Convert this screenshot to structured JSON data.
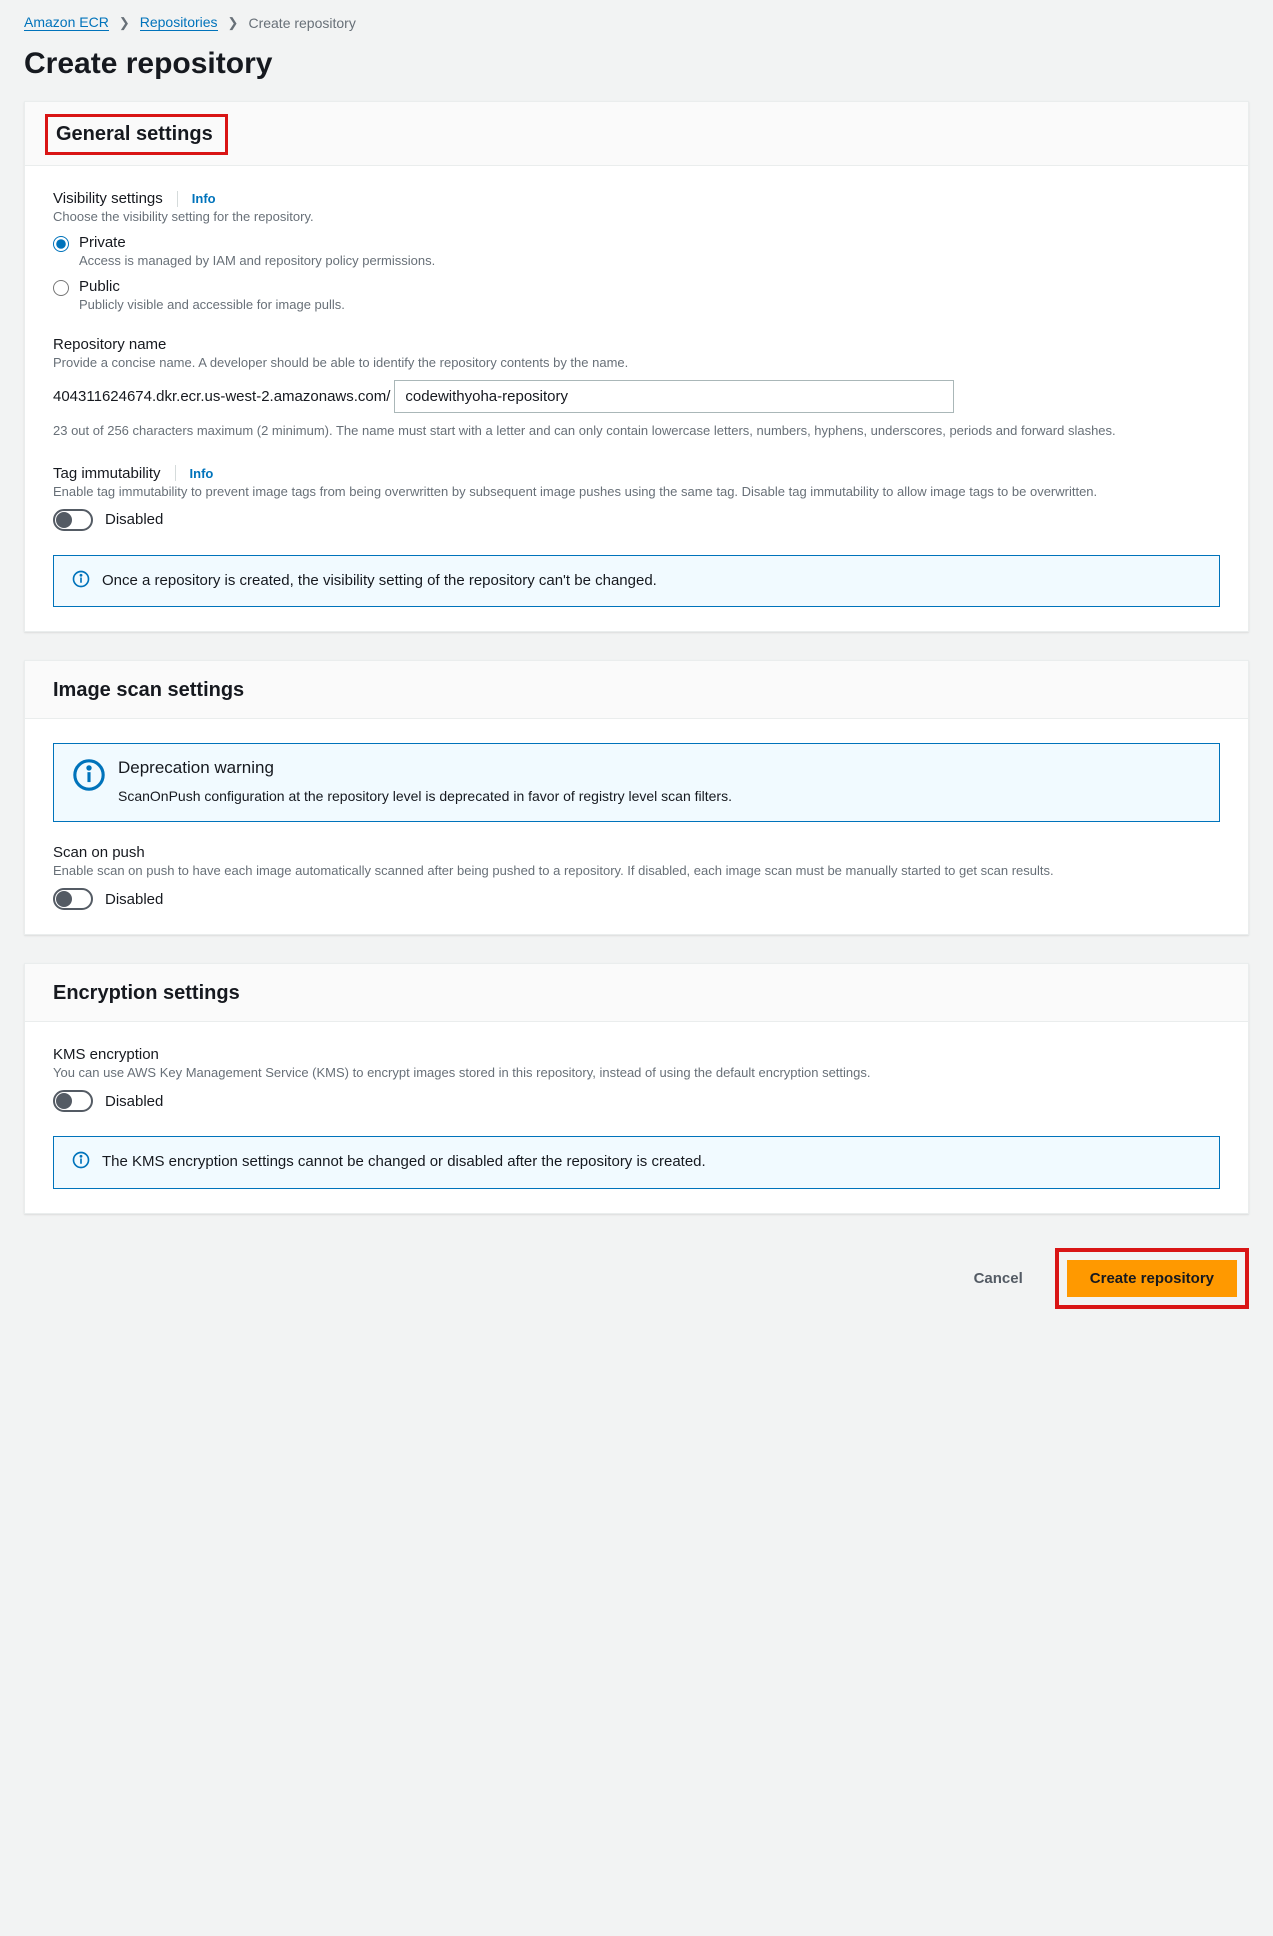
{
  "breadcrumb": {
    "root": "Amazon ECR",
    "mid": "Repositories",
    "current": "Create repository"
  },
  "page_title": "Create repository",
  "general": {
    "heading": "General settings",
    "visibility": {
      "label": "Visibility settings",
      "info": "Info",
      "desc": "Choose the visibility setting for the repository.",
      "private_label": "Private",
      "private_desc": "Access is managed by IAM and repository policy permissions.",
      "public_label": "Public",
      "public_desc": "Publicly visible and accessible for image pulls."
    },
    "repo_name": {
      "label": "Repository name",
      "desc": "Provide a concise name. A developer should be able to identify the repository contents by the name.",
      "prefix": "404311624674.dkr.ecr.us-west-2.amazonaws.com/",
      "value": "codewithyoha-repository",
      "hint": "23 out of 256 characters maximum (2 minimum). The name must start with a letter and can only contain lowercase letters, numbers, hyphens, underscores, periods and forward slashes."
    },
    "tag_immutability": {
      "label": "Tag immutability",
      "info": "Info",
      "desc": "Enable tag immutability to prevent image tags from being overwritten by subsequent image pushes using the same tag. Disable tag immutability to allow image tags to be overwritten.",
      "state": "Disabled"
    },
    "alert": "Once a repository is created, the visibility setting of the repository can't be changed."
  },
  "scan": {
    "heading": "Image scan settings",
    "deprecation_title": "Deprecation warning",
    "deprecation_text": "ScanOnPush configuration at the repository level is deprecated in favor of registry level scan filters.",
    "scan_on_push": {
      "label": "Scan on push",
      "desc": "Enable scan on push to have each image automatically scanned after being pushed to a repository. If disabled, each image scan must be manually started to get scan results.",
      "state": "Disabled"
    }
  },
  "encryption": {
    "heading": "Encryption settings",
    "kms": {
      "label": "KMS encryption",
      "desc": "You can use AWS Key Management Service (KMS) to encrypt images stored in this repository, instead of using the default encryption settings.",
      "state": "Disabled"
    },
    "alert": "The KMS encryption settings cannot be changed or disabled after the repository is created."
  },
  "actions": {
    "cancel": "Cancel",
    "create": "Create repository"
  }
}
